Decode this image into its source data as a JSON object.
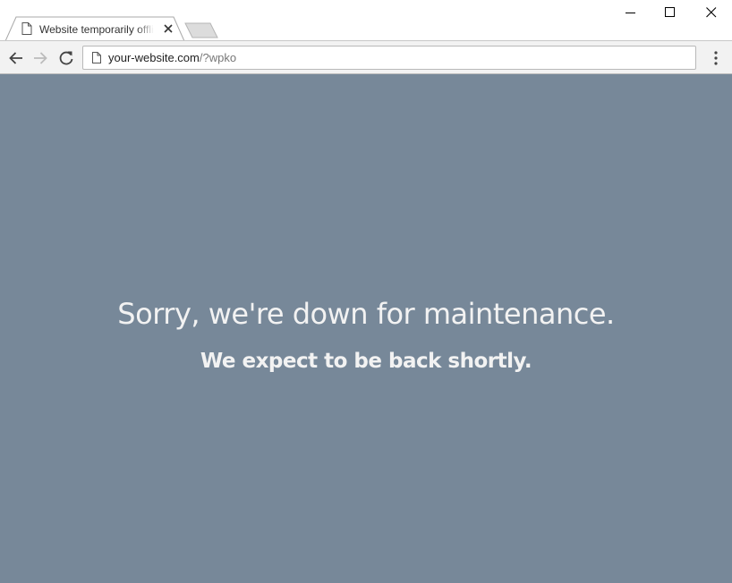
{
  "tab": {
    "title": "Website temporarily offline",
    "favicon_icon": "page-icon",
    "close_icon": "close-icon"
  },
  "window_controls": {
    "minimize_icon": "minimize-icon",
    "maximize_icon": "maximize-icon",
    "close_icon": "close-icon"
  },
  "toolbar": {
    "back_icon": "arrow-left-icon",
    "forward_icon": "arrow-right-icon",
    "reload_icon": "reload-icon",
    "menu_icon": "kebab-menu-icon"
  },
  "address_bar": {
    "host": "your-website.com",
    "path": "/?wpko",
    "icon": "page-icon"
  },
  "page": {
    "background_color": "#778899",
    "headline": "Sorry, we're down for maintenance.",
    "subline": "We expect to be back shortly."
  }
}
